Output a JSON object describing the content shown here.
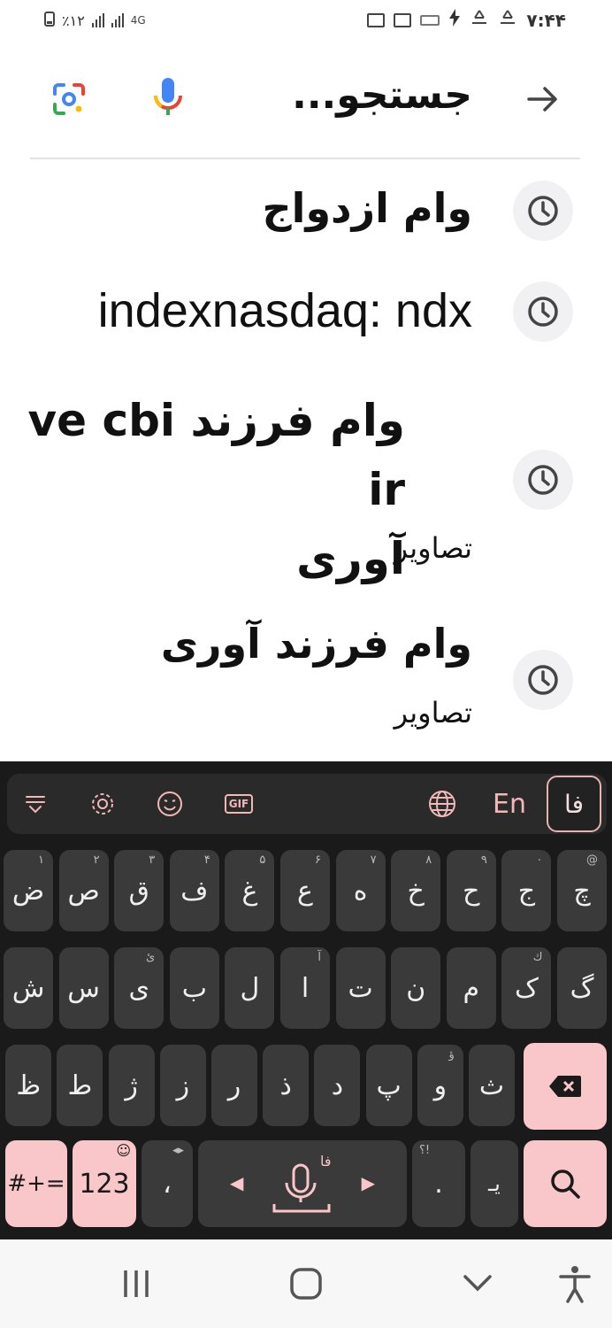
{
  "status_bar": {
    "time": "۷:۴۴",
    "battery": "٪۱۲",
    "network": "4G"
  },
  "search": {
    "query_text": "جستجو...",
    "icons": [
      "google-lens-icon",
      "voice-search-icon",
      "back-arrow-icon"
    ]
  },
  "history": [
    {
      "text": "وام ازدواج",
      "sub": ""
    },
    {
      "text": "indexnasdaq: ndx",
      "sub": ""
    },
    {
      "text_line1": "وام فرزند ve cbi ir",
      "text_line2": "آوری",
      "sub": "تصاویر"
    },
    {
      "text": "وام فرزند آوری",
      "sub": "تصاویر"
    }
  ],
  "keyboard": {
    "toolbar": {
      "gif_label": "GIF",
      "lang_en": "En",
      "lang_fa": "فا"
    },
    "row1": [
      {
        "char": "چ",
        "hint": "@"
      },
      {
        "char": "ج",
        "hint": "۰"
      },
      {
        "char": "ح",
        "hint": "۹"
      },
      {
        "char": "خ",
        "hint": "۸"
      },
      {
        "char": "ه",
        "hint": "۷"
      },
      {
        "char": "ع",
        "hint": "۶"
      },
      {
        "char": "غ",
        "hint": "۵"
      },
      {
        "char": "ف",
        "hint": "۴"
      },
      {
        "char": "ق",
        "hint": "۳"
      },
      {
        "char": "ص",
        "hint": "۲"
      },
      {
        "char": "ض",
        "hint": "۱"
      }
    ],
    "row2": [
      {
        "char": "گ",
        "hint": ""
      },
      {
        "char": "ک",
        "hint": "ك"
      },
      {
        "char": "م",
        "hint": ""
      },
      {
        "char": "ن",
        "hint": ""
      },
      {
        "char": "ت",
        "hint": ""
      },
      {
        "char": "ا",
        "hint": "آ"
      },
      {
        "char": "ل",
        "hint": ""
      },
      {
        "char": "ب",
        "hint": ""
      },
      {
        "char": "ی",
        "hint": "ئ"
      },
      {
        "char": "س",
        "hint": ""
      },
      {
        "char": "ش",
        "hint": ""
      }
    ],
    "row3": [
      {
        "char": "ث",
        "hint": ""
      },
      {
        "char": "و",
        "hint": "ؤ"
      },
      {
        "char": "پ",
        "hint": ""
      },
      {
        "char": "د",
        "hint": ""
      },
      {
        "char": "ذ",
        "hint": ""
      },
      {
        "char": "ر",
        "hint": ""
      },
      {
        "char": "ز",
        "hint": ""
      },
      {
        "char": "ژ",
        "hint": ""
      },
      {
        "char": "ط",
        "hint": ""
      },
      {
        "char": "ظ",
        "hint": ""
      }
    ],
    "row4": {
      "symbols": "#+=",
      "numbers": "123",
      "comma": "،",
      "space_lang": "فا",
      "dot": ".",
      "dot_hint": "؟!",
      "zwnj": "یـ"
    },
    "colors": {
      "accent_pink": "#f9c6c9",
      "key_dark": "#3a3a3a",
      "keyboard_bg": "#1a1a1a"
    }
  }
}
